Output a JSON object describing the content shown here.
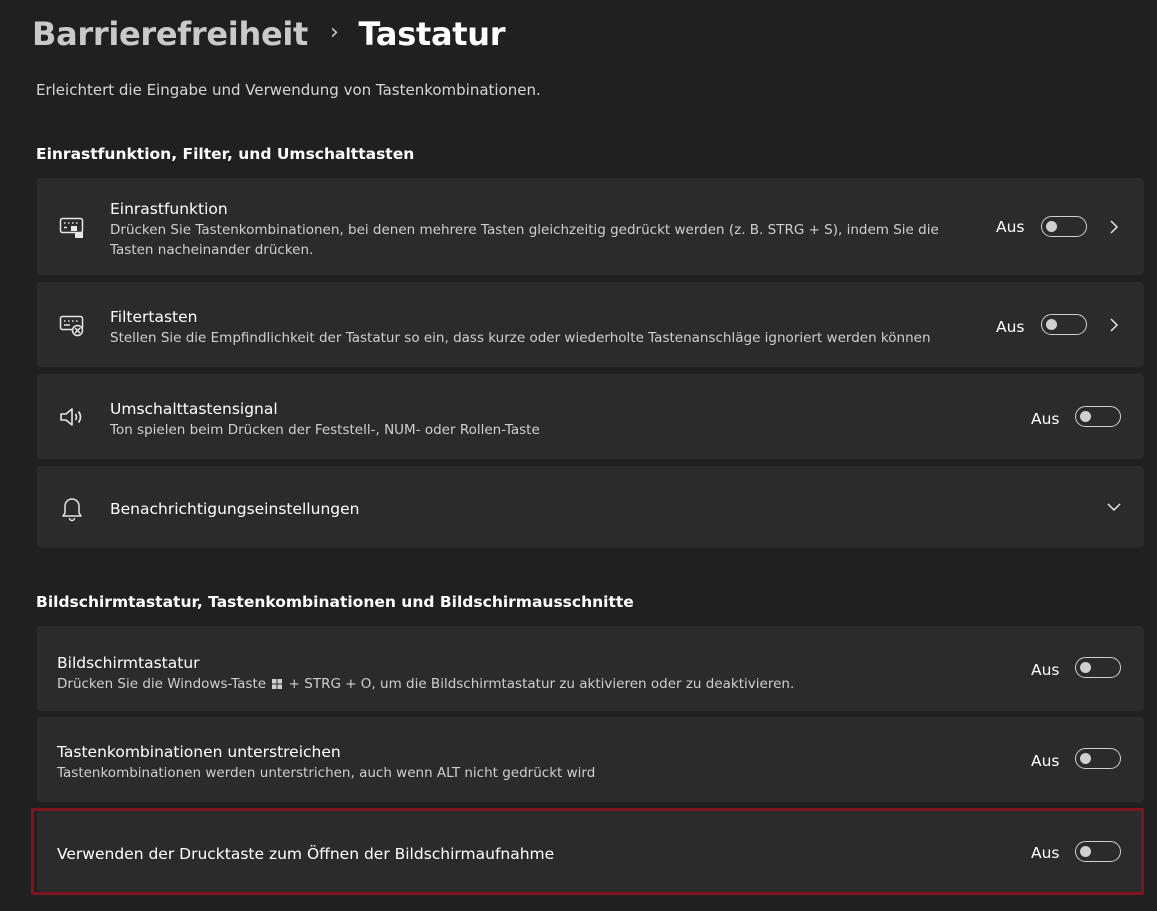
{
  "breadcrumb": {
    "parent": "Barrierefreiheit",
    "separator": "›",
    "current": "Tastatur"
  },
  "page_description": "Erleichtert die Eingabe und Verwendung von Tastenkombinationen.",
  "sections": [
    {
      "title": "Einrastfunktion, Filter, und Umschalttasten",
      "items": [
        {
          "icon": "sticky-keys-icon",
          "title": "Einrastfunktion",
          "desc_line1": "Drücken Sie Tastenkombinationen, bei denen mehrere Tasten gleichzeitig gedrückt werden (z. B. STRG + S), indem Sie die",
          "desc_line2": "Tasten nacheinander drücken.",
          "state": "Aus"
        },
        {
          "icon": "filter-keys-icon",
          "title": "Filtertasten",
          "desc": "Stellen Sie die Empfindlichkeit der Tastatur so ein, dass kurze oder wiederholte Tastenanschläge ignoriert werden können",
          "state": "Aus"
        },
        {
          "icon": "speaker-icon",
          "title": "Umschalttastensignal",
          "desc": "Ton spielen beim Drücken der Feststell-, NUM- oder Rollen-Taste",
          "state": "Aus"
        },
        {
          "icon": "bell-icon",
          "title": "Benachrichtigungseinstellungen"
        }
      ]
    },
    {
      "title": "Bildschirmtastatur, Tastenkombinationen und Bildschirmausschnitte",
      "items": [
        {
          "title": "Bildschirmtastatur",
          "desc_before": "Drücken Sie die Windows-Taste",
          "desc_after": "+ STRG + O, um die Bildschirmtastatur zu aktivieren oder zu deaktivieren.",
          "state": "Aus"
        },
        {
          "title": "Tastenkombinationen unterstreichen",
          "desc": "Tastenkombinationen werden unterstrichen, auch wenn ALT nicht gedrückt wird",
          "state": "Aus"
        },
        {
          "title": "Verwenden der Drucktaste zum Öffnen der Bildschirmaufnahme",
          "state": "Aus"
        }
      ]
    }
  ],
  "colors": {
    "background": "#202020",
    "card": "#2b2b2b",
    "highlight_border": "#7d1420"
  }
}
